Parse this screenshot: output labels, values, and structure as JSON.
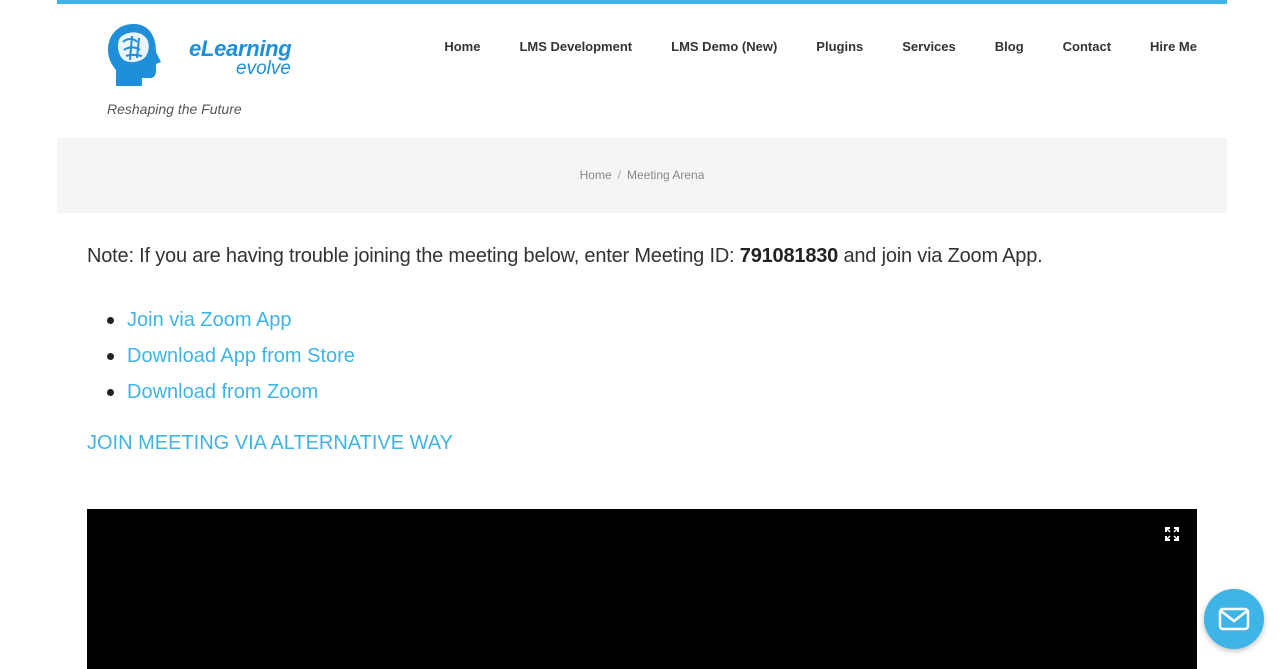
{
  "brand": {
    "name_line1": "eLearning",
    "name_line2": "evolve",
    "tagline": "Reshaping the Future",
    "accent_color": "#3fb4e6",
    "logo_color": "#1e8fd8"
  },
  "nav": {
    "items": [
      {
        "label": "Home"
      },
      {
        "label": "LMS Development"
      },
      {
        "label": "LMS Demo (New)"
      },
      {
        "label": "Plugins"
      },
      {
        "label": "Services"
      },
      {
        "label": "Blog"
      },
      {
        "label": "Contact"
      },
      {
        "label": "Hire Me"
      }
    ]
  },
  "breadcrumb": {
    "home": "Home",
    "separator": "/",
    "current": "Meeting Arena"
  },
  "main": {
    "note_prefix": "Note: If you are having trouble joining the meeting below, enter Meeting ID: ",
    "meeting_id": "791081830",
    "note_suffix": " and join via Zoom App.",
    "links": [
      {
        "label": "Join via Zoom App"
      },
      {
        "label": "Download App from Store"
      },
      {
        "label": "Download from Zoom"
      }
    ],
    "alternative_link": "JOIN MEETING VIA ALTERNATIVE WAY"
  },
  "icons": {
    "logo": "brain-head-icon",
    "fullscreen": "fullscreen-icon",
    "mail": "mail-icon"
  }
}
